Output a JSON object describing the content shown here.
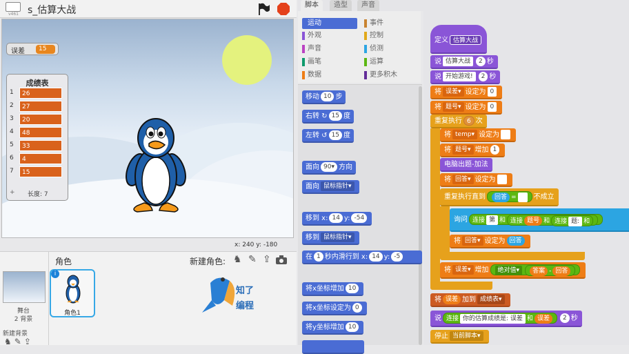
{
  "app": {
    "project_name": "s_估算大战",
    "version": "v461"
  },
  "stage": {
    "error_monitor": {
      "label": "误差",
      "value": "15"
    },
    "list_monitor": {
      "title": "成绩表",
      "items": [
        {
          "index": "1",
          "value": "26"
        },
        {
          "index": "2",
          "value": "27"
        },
        {
          "index": "3",
          "value": "20"
        },
        {
          "index": "4",
          "value": "48"
        },
        {
          "index": "5",
          "value": "33"
        },
        {
          "index": "6",
          "value": "4"
        },
        {
          "index": "7",
          "value": "15"
        }
      ],
      "add": "+",
      "length": "长度: 7"
    },
    "coords": "x: 240  y: -180"
  },
  "sprites": {
    "header": "角色",
    "new_sprite_label": "新建角色:",
    "stage_label": "舞台",
    "bg_count": "2 背景",
    "new_bg": "新建背景",
    "sprite_name": "角色1",
    "logo_line1": "知了",
    "logo_line2": "编程"
  },
  "tabs": [
    "脚本",
    "造型",
    "声音"
  ],
  "categories": [
    {
      "label": "运动",
      "color": "#4a6cd4",
      "active": true
    },
    {
      "label": "事件",
      "color": "#c88330"
    },
    {
      "label": "外观",
      "color": "#8a55d7"
    },
    {
      "label": "控制",
      "color": "#e1a91a"
    },
    {
      "label": "声音",
      "color": "#bb42c3"
    },
    {
      "label": "侦测",
      "color": "#2ca5e2"
    },
    {
      "label": "画笔",
      "color": "#0e9a6c"
    },
    {
      "label": "运算",
      "color": "#5cb712"
    },
    {
      "label": "数据",
      "color": "#ee7d16"
    },
    {
      "label": "更多积木",
      "color": "#632d99"
    }
  ],
  "palette": {
    "move": {
      "a": "移动",
      "n": "10",
      "b": "步"
    },
    "turn_right": {
      "a": "右转",
      "n": "15",
      "b": "度"
    },
    "turn_left": {
      "a": "左转",
      "n": "15",
      "b": "度"
    },
    "point_dir": {
      "a": "面向",
      "n": "90▾",
      "b": "方向"
    },
    "point_to": {
      "a": "面向",
      "dd": "鼠标指针▾"
    },
    "goto_xy": {
      "a": "移到 x:",
      "x": "14",
      "b": "y:",
      "y": "-54"
    },
    "goto": {
      "a": "移到",
      "dd": "鼠标指针▾"
    },
    "glide": {
      "a": "在",
      "n": "1",
      "b": "秒内滑行到 x:",
      "x": "14",
      "c": "y:",
      "y": "-5"
    },
    "change_x": {
      "a": "将x坐标增加",
      "n": "10"
    },
    "set_x": {
      "a": "将x坐标设定为",
      "n": "0"
    },
    "change_y": {
      "a": "将y坐标增加",
      "n": "10"
    }
  },
  "script": {
    "define": {
      "a": "定义",
      "name": "估算大战"
    },
    "say1": {
      "a": "说",
      "text": "估算大战",
      "n": "2",
      "b": "秒"
    },
    "say2": {
      "a": "说",
      "text": "开始游戏!",
      "n": "2",
      "b": "秒"
    },
    "set_err": {
      "a": "将",
      "var": "误差▾",
      "b": "设定为",
      "v": "0"
    },
    "set_num": {
      "a": "将",
      "var": "题号▾",
      "b": "设定为",
      "v": "0"
    },
    "repeat": {
      "a": "重复执行",
      "n": "6",
      "b": "次"
    },
    "set_temp": {
      "a": "将",
      "var": "temp▾",
      "b": "设定为",
      "v": ""
    },
    "chg_num": {
      "a": "将",
      "var": "题号▾",
      "b": "增加",
      "v": "1"
    },
    "call": {
      "a": "电脑出题-加法"
    },
    "set_ans": {
      "a": "将",
      "var": "回答▾",
      "b": "设定为",
      "v": ""
    },
    "until": {
      "a": "重复执行直到",
      "lhs": "回答",
      "eq": "=",
      "rhs": "",
      "b": "不成立"
    },
    "ask": {
      "a": "询问",
      "j1": "连接",
      "t1": "第",
      "and1": "和",
      "j2": "连接",
      "r1": "题号",
      "and2": "和",
      "j3": "连接",
      "t2": "题:",
      "and3": "和"
    },
    "set_ans2": {
      "a": "将",
      "var": "回答▾",
      "b": "设定为",
      "v": "回答"
    },
    "chg_err": {
      "a": "将",
      "var": "误差▾",
      "b": "增加",
      "abs": "绝对值▾",
      "r1": "答案",
      "minus": "-",
      "r2": "回答"
    },
    "add_list": {
      "a": "将",
      "v": "误差",
      "b": "加到",
      "list": "成绩表▾"
    },
    "say3": {
      "a": "说",
      "j": "连接",
      "text": "你的估算成绩是: 误差",
      "and": "和",
      "r": "误差",
      "n": "2",
      "b": "秒"
    },
    "stop": {
      "a": "停止",
      "dd": "当前脚本▾"
    }
  },
  "colors": {
    "accent": "#36a8e6",
    "list_item": "#d9621c",
    "monitor_value": "#e8861e"
  }
}
